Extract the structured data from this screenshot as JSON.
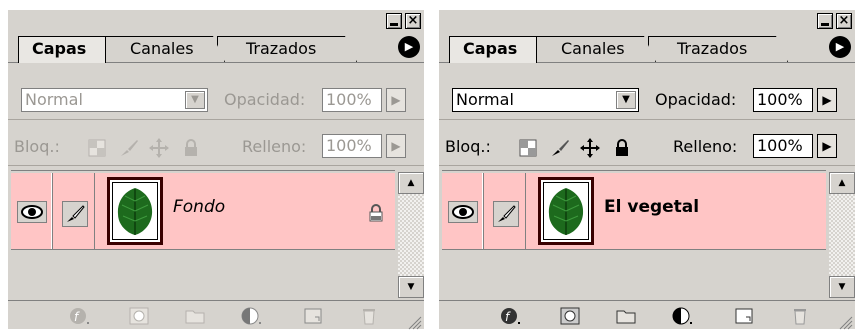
{
  "colors": {
    "panel_bg": "#d6d3ce",
    "selected_layer_bg": "#ffc5c5",
    "disabled_text": "#9b9893"
  },
  "panels": [
    {
      "state": "disabled",
      "titlebar": {
        "minimize_icon": "minimize-icon",
        "close_icon": "close-icon",
        "close_label": "×"
      },
      "tabs": [
        {
          "label": "Capas",
          "active": true
        },
        {
          "label": "Canales",
          "active": false
        },
        {
          "label": "Trazados",
          "active": false
        }
      ],
      "menu_icon": "panel-menu-arrow-icon",
      "blend_mode": "Normal",
      "opacity_label": "Opacidad:",
      "opacity_value": "100%",
      "lock_label": "Bloq.:",
      "lock_icons": [
        "lock-transparency-icon",
        "lock-paint-icon",
        "lock-move-icon",
        "lock-all-icon"
      ],
      "fill_label": "Relleno:",
      "fill_value": "100%",
      "layer": {
        "name": "Fondo",
        "italic": true,
        "locked": true,
        "thumbnail": "leaf-thumbnail"
      },
      "bottom_icons": [
        "layer-style-icon",
        "layer-mask-icon",
        "layer-set-icon",
        "adjustment-layer-icon",
        "new-layer-icon",
        "trash-icon"
      ]
    },
    {
      "state": "enabled",
      "titlebar": {
        "minimize_icon": "minimize-icon",
        "close_icon": "close-icon",
        "close_label": "×"
      },
      "tabs": [
        {
          "label": "Capas",
          "active": true
        },
        {
          "label": "Canales",
          "active": false
        },
        {
          "label": "Trazados",
          "active": false
        }
      ],
      "menu_icon": "panel-menu-arrow-icon",
      "blend_mode": "Normal",
      "opacity_label": "Opacidad:",
      "opacity_value": "100%",
      "lock_label": "Bloq.:",
      "lock_icons": [
        "lock-transparency-icon",
        "lock-paint-icon",
        "lock-move-icon",
        "lock-all-icon"
      ],
      "fill_label": "Relleno:",
      "fill_value": "100%",
      "layer": {
        "name": "El vegetal",
        "italic": false,
        "locked": false,
        "thumbnail": "leaf-thumbnail"
      },
      "bottom_icons": [
        "layer-style-icon",
        "layer-mask-icon",
        "layer-set-icon",
        "adjustment-layer-icon",
        "new-layer-icon",
        "trash-icon"
      ]
    }
  ]
}
